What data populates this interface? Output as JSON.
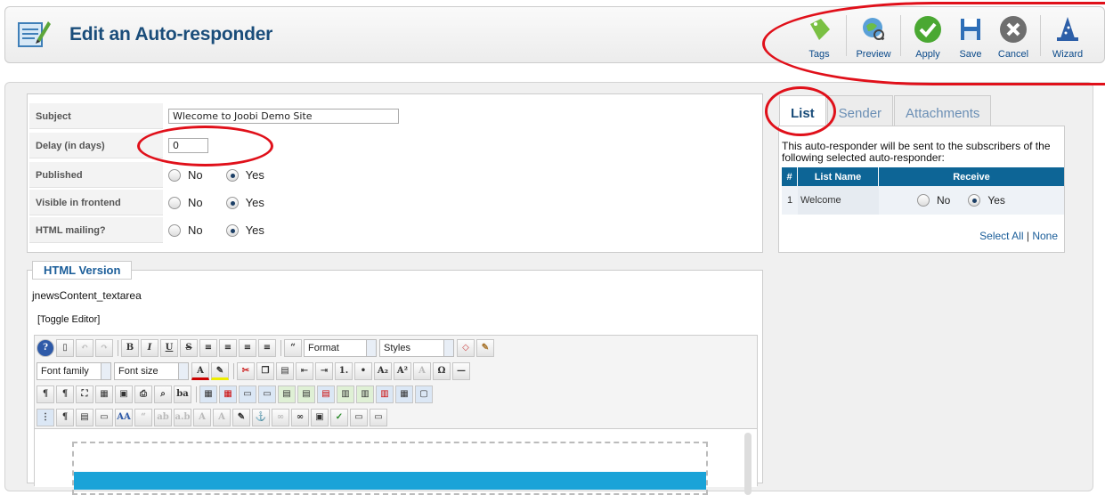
{
  "header": {
    "title": "Edit an Auto-responder",
    "toolbar": [
      {
        "label": "Tags",
        "icon": "tag-icon",
        "color": "#7ac043"
      },
      {
        "label": "Preview",
        "icon": "preview-globe-icon",
        "color": "#5aa0d8"
      },
      {
        "label": "Apply",
        "icon": "check-icon",
        "color": "#4aa832"
      },
      {
        "label": "Save",
        "icon": "floppy-disk-icon",
        "color": "#2f6fb8"
      },
      {
        "label": "Cancel",
        "icon": "close-icon",
        "color": "#6e6e6e"
      },
      {
        "label": "Wizard",
        "icon": "wizard-hat-icon",
        "color": "#2d5fa8"
      }
    ]
  },
  "form": {
    "subject_label": "Subject",
    "subject_value": "Wlecome to Joobi Demo Site",
    "delay_label": "Delay (in days)",
    "delay_value": "0",
    "published_label": "Published",
    "visible_label": "Visible in frontend",
    "html_label": "HTML mailing?",
    "no_label": "No",
    "yes_label": "Yes"
  },
  "editor": {
    "legend": "HTML Version",
    "textarea_name": "jnewsContent_textarea",
    "toggle": "[Toggle Editor]",
    "format_label": "Format",
    "styles_label": "Styles",
    "font_family_label": "Font family",
    "font_size_label": "Font size"
  },
  "sidebar": {
    "tabs": [
      "List",
      "Sender",
      "Attachments"
    ],
    "description": "This auto-responder will be sent to the subscribers of the following selected auto-responder:",
    "table": {
      "headers": [
        "#",
        "List Name",
        "Receive"
      ],
      "rows": [
        {
          "num": "1",
          "name": "Welcome",
          "no": "No",
          "yes": "Yes"
        }
      ]
    },
    "select_all": "Select All",
    "separator": "|",
    "none": "None"
  },
  "colors": {
    "annotation": "#e0101a",
    "table_header": "#0d6596",
    "title": "#1a4d7a"
  }
}
